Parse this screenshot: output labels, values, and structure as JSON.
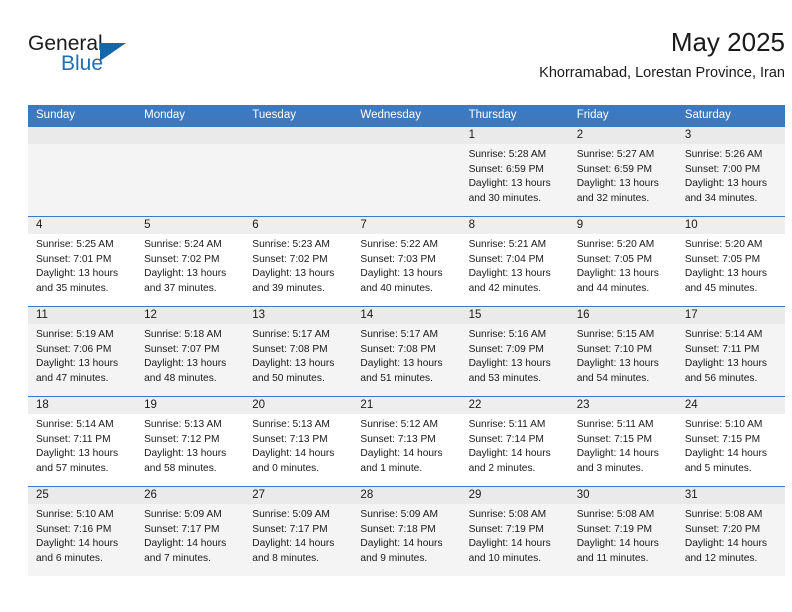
{
  "brand": {
    "name_part1": "General",
    "name_part2": "Blue",
    "triangle_icon": "triangle-icon",
    "accent_color": "#1267a8"
  },
  "header": {
    "title": "May 2025",
    "subtitle": "Khorramabad, Lorestan Province, Iran"
  },
  "colors": {
    "header_blue": "#3c79bf",
    "row_shaded": "#f4f4f4",
    "number_band": "#eaeaea",
    "text": "#1a1a1a"
  },
  "weekdays": [
    "Sunday",
    "Monday",
    "Tuesday",
    "Wednesday",
    "Thursday",
    "Friday",
    "Saturday"
  ],
  "weeks": [
    [
      {
        "day": "",
        "sunrise": "",
        "sunset": "",
        "daylight1": "",
        "daylight2": ""
      },
      {
        "day": "",
        "sunrise": "",
        "sunset": "",
        "daylight1": "",
        "daylight2": ""
      },
      {
        "day": "",
        "sunrise": "",
        "sunset": "",
        "daylight1": "",
        "daylight2": ""
      },
      {
        "day": "",
        "sunrise": "",
        "sunset": "",
        "daylight1": "",
        "daylight2": ""
      },
      {
        "day": "1",
        "sunrise": "Sunrise: 5:28 AM",
        "sunset": "Sunset: 6:59 PM",
        "daylight1": "Daylight: 13 hours",
        "daylight2": "and 30 minutes."
      },
      {
        "day": "2",
        "sunrise": "Sunrise: 5:27 AM",
        "sunset": "Sunset: 6:59 PM",
        "daylight1": "Daylight: 13 hours",
        "daylight2": "and 32 minutes."
      },
      {
        "day": "3",
        "sunrise": "Sunrise: 5:26 AM",
        "sunset": "Sunset: 7:00 PM",
        "daylight1": "Daylight: 13 hours",
        "daylight2": "and 34 minutes."
      }
    ],
    [
      {
        "day": "4",
        "sunrise": "Sunrise: 5:25 AM",
        "sunset": "Sunset: 7:01 PM",
        "daylight1": "Daylight: 13 hours",
        "daylight2": "and 35 minutes."
      },
      {
        "day": "5",
        "sunrise": "Sunrise: 5:24 AM",
        "sunset": "Sunset: 7:02 PM",
        "daylight1": "Daylight: 13 hours",
        "daylight2": "and 37 minutes."
      },
      {
        "day": "6",
        "sunrise": "Sunrise: 5:23 AM",
        "sunset": "Sunset: 7:02 PM",
        "daylight1": "Daylight: 13 hours",
        "daylight2": "and 39 minutes."
      },
      {
        "day": "7",
        "sunrise": "Sunrise: 5:22 AM",
        "sunset": "Sunset: 7:03 PM",
        "daylight1": "Daylight: 13 hours",
        "daylight2": "and 40 minutes."
      },
      {
        "day": "8",
        "sunrise": "Sunrise: 5:21 AM",
        "sunset": "Sunset: 7:04 PM",
        "daylight1": "Daylight: 13 hours",
        "daylight2": "and 42 minutes."
      },
      {
        "day": "9",
        "sunrise": "Sunrise: 5:20 AM",
        "sunset": "Sunset: 7:05 PM",
        "daylight1": "Daylight: 13 hours",
        "daylight2": "and 44 minutes."
      },
      {
        "day": "10",
        "sunrise": "Sunrise: 5:20 AM",
        "sunset": "Sunset: 7:05 PM",
        "daylight1": "Daylight: 13 hours",
        "daylight2": "and 45 minutes."
      }
    ],
    [
      {
        "day": "11",
        "sunrise": "Sunrise: 5:19 AM",
        "sunset": "Sunset: 7:06 PM",
        "daylight1": "Daylight: 13 hours",
        "daylight2": "and 47 minutes."
      },
      {
        "day": "12",
        "sunrise": "Sunrise: 5:18 AM",
        "sunset": "Sunset: 7:07 PM",
        "daylight1": "Daylight: 13 hours",
        "daylight2": "and 48 minutes."
      },
      {
        "day": "13",
        "sunrise": "Sunrise: 5:17 AM",
        "sunset": "Sunset: 7:08 PM",
        "daylight1": "Daylight: 13 hours",
        "daylight2": "and 50 minutes."
      },
      {
        "day": "14",
        "sunrise": "Sunrise: 5:17 AM",
        "sunset": "Sunset: 7:08 PM",
        "daylight1": "Daylight: 13 hours",
        "daylight2": "and 51 minutes."
      },
      {
        "day": "15",
        "sunrise": "Sunrise: 5:16 AM",
        "sunset": "Sunset: 7:09 PM",
        "daylight1": "Daylight: 13 hours",
        "daylight2": "and 53 minutes."
      },
      {
        "day": "16",
        "sunrise": "Sunrise: 5:15 AM",
        "sunset": "Sunset: 7:10 PM",
        "daylight1": "Daylight: 13 hours",
        "daylight2": "and 54 minutes."
      },
      {
        "day": "17",
        "sunrise": "Sunrise: 5:14 AM",
        "sunset": "Sunset: 7:11 PM",
        "daylight1": "Daylight: 13 hours",
        "daylight2": "and 56 minutes."
      }
    ],
    [
      {
        "day": "18",
        "sunrise": "Sunrise: 5:14 AM",
        "sunset": "Sunset: 7:11 PM",
        "daylight1": "Daylight: 13 hours",
        "daylight2": "and 57 minutes."
      },
      {
        "day": "19",
        "sunrise": "Sunrise: 5:13 AM",
        "sunset": "Sunset: 7:12 PM",
        "daylight1": "Daylight: 13 hours",
        "daylight2": "and 58 minutes."
      },
      {
        "day": "20",
        "sunrise": "Sunrise: 5:13 AM",
        "sunset": "Sunset: 7:13 PM",
        "daylight1": "Daylight: 14 hours",
        "daylight2": "and 0 minutes."
      },
      {
        "day": "21",
        "sunrise": "Sunrise: 5:12 AM",
        "sunset": "Sunset: 7:13 PM",
        "daylight1": "Daylight: 14 hours",
        "daylight2": "and 1 minute."
      },
      {
        "day": "22",
        "sunrise": "Sunrise: 5:11 AM",
        "sunset": "Sunset: 7:14 PM",
        "daylight1": "Daylight: 14 hours",
        "daylight2": "and 2 minutes."
      },
      {
        "day": "23",
        "sunrise": "Sunrise: 5:11 AM",
        "sunset": "Sunset: 7:15 PM",
        "daylight1": "Daylight: 14 hours",
        "daylight2": "and 3 minutes."
      },
      {
        "day": "24",
        "sunrise": "Sunrise: 5:10 AM",
        "sunset": "Sunset: 7:15 PM",
        "daylight1": "Daylight: 14 hours",
        "daylight2": "and 5 minutes."
      }
    ],
    [
      {
        "day": "25",
        "sunrise": "Sunrise: 5:10 AM",
        "sunset": "Sunset: 7:16 PM",
        "daylight1": "Daylight: 14 hours",
        "daylight2": "and 6 minutes."
      },
      {
        "day": "26",
        "sunrise": "Sunrise: 5:09 AM",
        "sunset": "Sunset: 7:17 PM",
        "daylight1": "Daylight: 14 hours",
        "daylight2": "and 7 minutes."
      },
      {
        "day": "27",
        "sunrise": "Sunrise: 5:09 AM",
        "sunset": "Sunset: 7:17 PM",
        "daylight1": "Daylight: 14 hours",
        "daylight2": "and 8 minutes."
      },
      {
        "day": "28",
        "sunrise": "Sunrise: 5:09 AM",
        "sunset": "Sunset: 7:18 PM",
        "daylight1": "Daylight: 14 hours",
        "daylight2": "and 9 minutes."
      },
      {
        "day": "29",
        "sunrise": "Sunrise: 5:08 AM",
        "sunset": "Sunset: 7:19 PM",
        "daylight1": "Daylight: 14 hours",
        "daylight2": "and 10 minutes."
      },
      {
        "day": "30",
        "sunrise": "Sunrise: 5:08 AM",
        "sunset": "Sunset: 7:19 PM",
        "daylight1": "Daylight: 14 hours",
        "daylight2": "and 11 minutes."
      },
      {
        "day": "31",
        "sunrise": "Sunrise: 5:08 AM",
        "sunset": "Sunset: 7:20 PM",
        "daylight1": "Daylight: 14 hours",
        "daylight2": "and 12 minutes."
      }
    ]
  ]
}
